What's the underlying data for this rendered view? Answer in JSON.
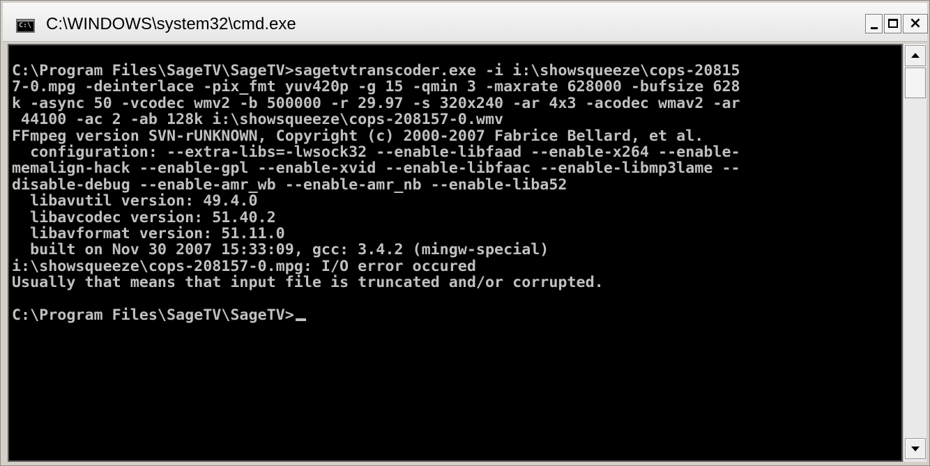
{
  "window": {
    "title": "C:\\WINDOWS\\system32\\cmd.exe",
    "icon_label": "C:\\",
    "minimize_label": "_",
    "maximize_label": "",
    "close_label": "×"
  },
  "console": {
    "lines": [
      "C:\\Program Files\\SageTV\\SageTV>sagetvtranscoder.exe -i i:\\showsqueeze\\cops-20815",
      "7-0.mpg -deinterlace -pix_fmt yuv420p -g 15 -qmin 3 -maxrate 628000 -bufsize 628",
      "k -async 50 -vcodec wmv2 -b 500000 -r 29.97 -s 320x240 -ar 4x3 -acodec wmav2 -ar",
      " 44100 -ac 2 -ab 128k i:\\showsqueeze\\cops-208157-0.wmv",
      "FFmpeg version SVN-rUNKNOWN, Copyright (c) 2000-2007 Fabrice Bellard, et al.",
      "  configuration: --extra-libs=-lwsock32 --enable-libfaad --enable-x264 --enable-",
      "memalign-hack --enable-gpl --enable-xvid --enable-libfaac --enable-libmp3lame --",
      "disable-debug --enable-amr_wb --enable-amr_nb --enable-liba52",
      "  libavutil version: 49.4.0",
      "  libavcodec version: 51.40.2",
      "  libavformat version: 51.11.0",
      "  built on Nov 30 2007 15:33:09, gcc: 3.4.2 (mingw-special)",
      "i:\\showsqueeze\\cops-208157-0.mpg: I/O error occured",
      "Usually that means that input file is truncated and/or corrupted.",
      "",
      "C:\\Program Files\\SageTV\\SageTV>"
    ]
  },
  "colors": {
    "console_bg": "#000000",
    "console_fg": "#c0c0c0",
    "chrome": "#d4d0c8"
  }
}
